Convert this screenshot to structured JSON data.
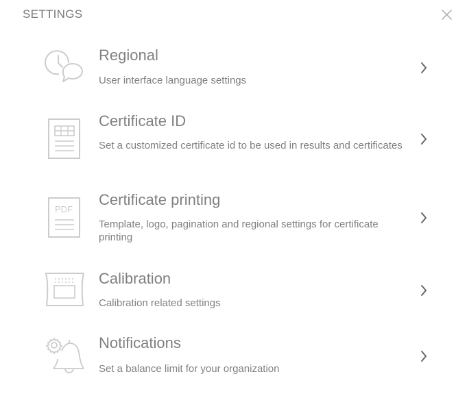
{
  "header": {
    "title": "SETTINGS",
    "close_icon": "close-icon"
  },
  "items": [
    {
      "title": "Regional",
      "description": "User interface language settings",
      "icon": "clock-chat-icon"
    },
    {
      "title": "Certificate ID",
      "description": "Set a customized certificate id to be used in results and certificates",
      "icon": "certificate-document-icon"
    },
    {
      "title": "Certificate printing",
      "description": "Template, logo, pagination and regional settings for certificate printing",
      "icon": "pdf-document-icon",
      "icon_text": "PDF"
    },
    {
      "title": "Calibration",
      "description": "Calibration related settings",
      "icon": "calibration-device-icon"
    },
    {
      "title": "Notifications",
      "description": "Set a balance limit for your organization",
      "icon": "bell-gear-icon"
    }
  ],
  "colors": {
    "text": "#808080",
    "icon": "#cccccc",
    "chevron": "#666666"
  }
}
